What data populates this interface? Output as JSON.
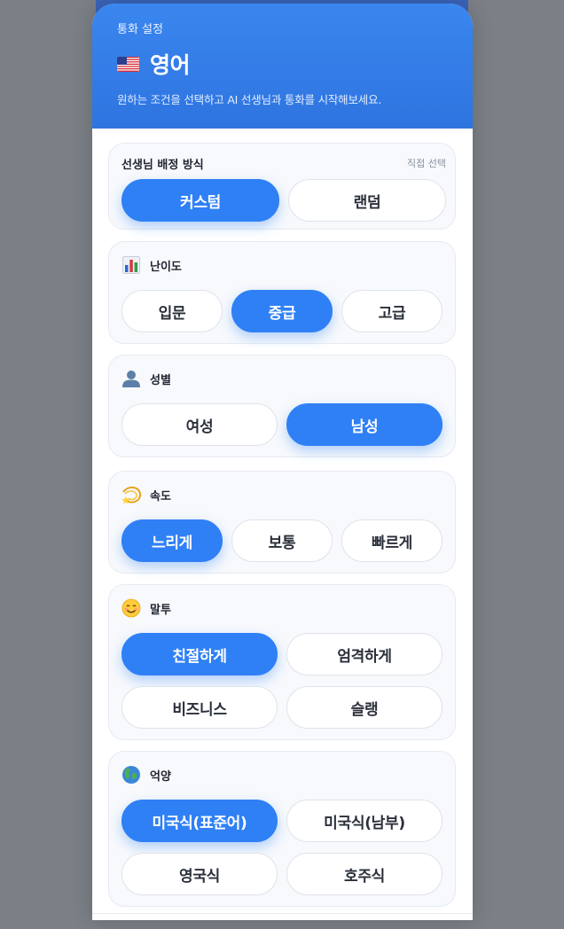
{
  "header": {
    "subtitle": "통화 설정",
    "flag_icon": "us-flag-icon",
    "language": "영어",
    "description": "원하는 조건을 선택하고 AI 선생님과 통화를 시작해보세요."
  },
  "assignment": {
    "title": "선생님 배정 방식",
    "note": "직접 선택",
    "options": [
      "커스텀",
      "랜덤"
    ],
    "selected": "커스텀"
  },
  "difficulty": {
    "icon": "bar-chart-icon",
    "title": "난이도",
    "options": [
      "입문",
      "중급",
      "고급"
    ],
    "selected": "중급"
  },
  "gender": {
    "icon": "person-icon",
    "title": "성별",
    "options": [
      "여성",
      "남성"
    ],
    "selected": "남성"
  },
  "speed": {
    "icon": "dizzy-star-icon",
    "title": "속도",
    "options": [
      "느리게",
      "보통",
      "빠르게"
    ],
    "selected": "느리게"
  },
  "tone": {
    "icon": "smile-icon",
    "title": "말투",
    "options": [
      "친절하게",
      "엄격하게",
      "비즈니스",
      "슬랭"
    ],
    "selected": "친절하게"
  },
  "accent": {
    "icon": "globe-icon",
    "title": "억양",
    "options": [
      "미국식(표준어)",
      "미국식(남부)",
      "영국식",
      "호주식"
    ],
    "selected": "미국식(표준어)"
  },
  "colors": {
    "primary": "#2f80f5",
    "header_top": "#3a86ef",
    "header_bottom": "#2e74e0",
    "card_bg": "#f7f9fc",
    "backdrop": "#7b7f86"
  }
}
